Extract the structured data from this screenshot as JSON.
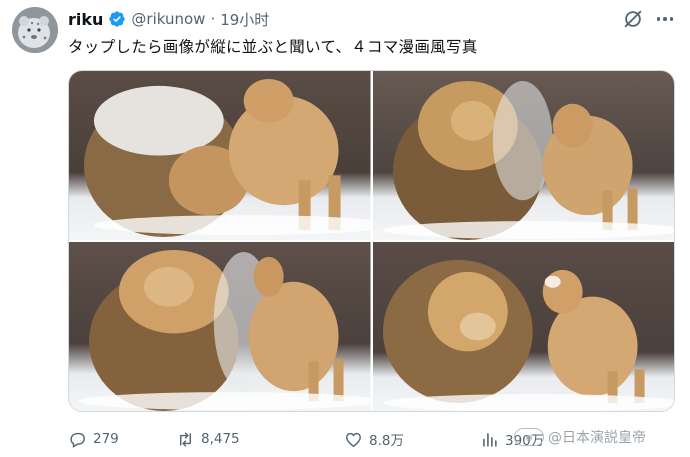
{
  "tweet": {
    "author_name": "riku",
    "handle": "@rikunow",
    "separator": "·",
    "time": "19小时",
    "text": "タップしたら画像が縦に並ぶと聞いて、４コマ漫画風写真",
    "verified": true
  },
  "media": {
    "photos": [
      {
        "icon": "lion-photo",
        "desc_key": "photo-1"
      },
      {
        "icon": "lion-photo",
        "desc_key": "photo-2"
      },
      {
        "icon": "lion-photo",
        "desc_key": "photo-3"
      },
      {
        "icon": "lion-photo",
        "desc_key": "photo-4"
      }
    ]
  },
  "actions": {
    "replies": "279",
    "reposts": "8,475",
    "likes": "8.8万",
    "views": "390万"
  },
  "watermark": {
    "text": "@日本演説皇帝"
  },
  "colors": {
    "verified_blue": "#1d9bf0",
    "secondary_text": "#536471",
    "primary_text": "#0f1419"
  }
}
